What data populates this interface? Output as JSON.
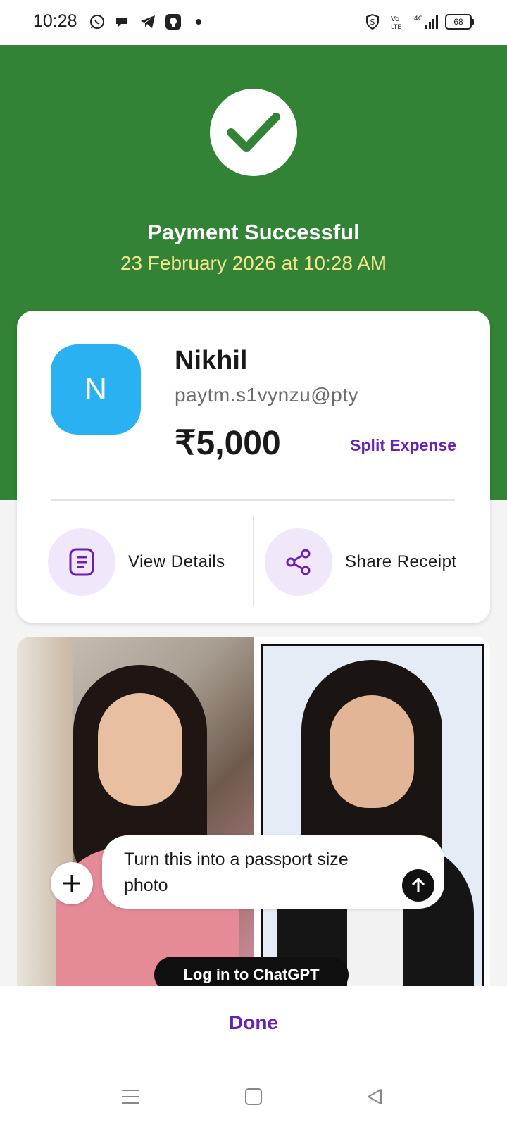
{
  "status_bar": {
    "time": "10:28",
    "network": "4G",
    "battery": "68"
  },
  "header": {
    "title": "Payment Successful",
    "datetime": "23 February 2026 at 10:28 AM",
    "accent_color": "#328336"
  },
  "payee": {
    "initial": "N",
    "name": "Nikhil",
    "upi_id": "paytm.s1vynzu@pty",
    "amount": "₹5,000",
    "split_label": "Split Expense"
  },
  "actions": {
    "view_details": "View Details",
    "share_receipt": "Share Receipt"
  },
  "ad": {
    "prompt_text": "Turn this into a passport size photo",
    "login_label": "Log in to ChatGPT"
  },
  "footer": {
    "done_label": "Done"
  },
  "nav": {
    "items": [
      "menu-icon",
      "home-icon",
      "back-icon"
    ]
  }
}
